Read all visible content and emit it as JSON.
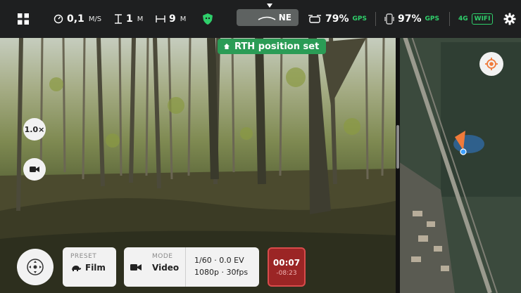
{
  "statusbar": {
    "speed_value": "0,1",
    "speed_unit": "M/S",
    "altitude_value": "1",
    "altitude_unit": "M",
    "distance_value": "9",
    "distance_unit": "M",
    "heading": "NE",
    "drone_battery": "79%",
    "drone_gps": "GPS",
    "controller_battery": "97%",
    "controller_gps": "GPS",
    "network": "4G",
    "wifi": "WIFI"
  },
  "banner": {
    "text": "RTH position set"
  },
  "camera": {
    "zoom": "1.0×"
  },
  "bottom": {
    "preset_label": "PRESET",
    "preset_value": "Film",
    "mode_label": "MODE",
    "mode_value": "Video",
    "exposure": "1/60 · 0.0 EV",
    "resolution": "1080p · 30fps",
    "rec_elapsed": "00:07",
    "rec_remaining": "-08:23"
  },
  "icons": {
    "menu": "grid-icon",
    "speed": "speedometer-icon",
    "altitude": "altitude-icon",
    "distance": "distance-icon",
    "shield": "shield-icon",
    "drone": "drone-icon",
    "controller": "controller-icon",
    "settings": "gear-icon",
    "home": "home-icon",
    "locate": "locate-icon",
    "video": "video-camera-icon",
    "preset": "turtle-icon",
    "joystick": "joystick-icon"
  },
  "colors": {
    "accent_green": "#2fcf6b",
    "rth_green": "#2b9c56",
    "record_red": "#9b2525",
    "drone_marker": "#f07a3a"
  }
}
